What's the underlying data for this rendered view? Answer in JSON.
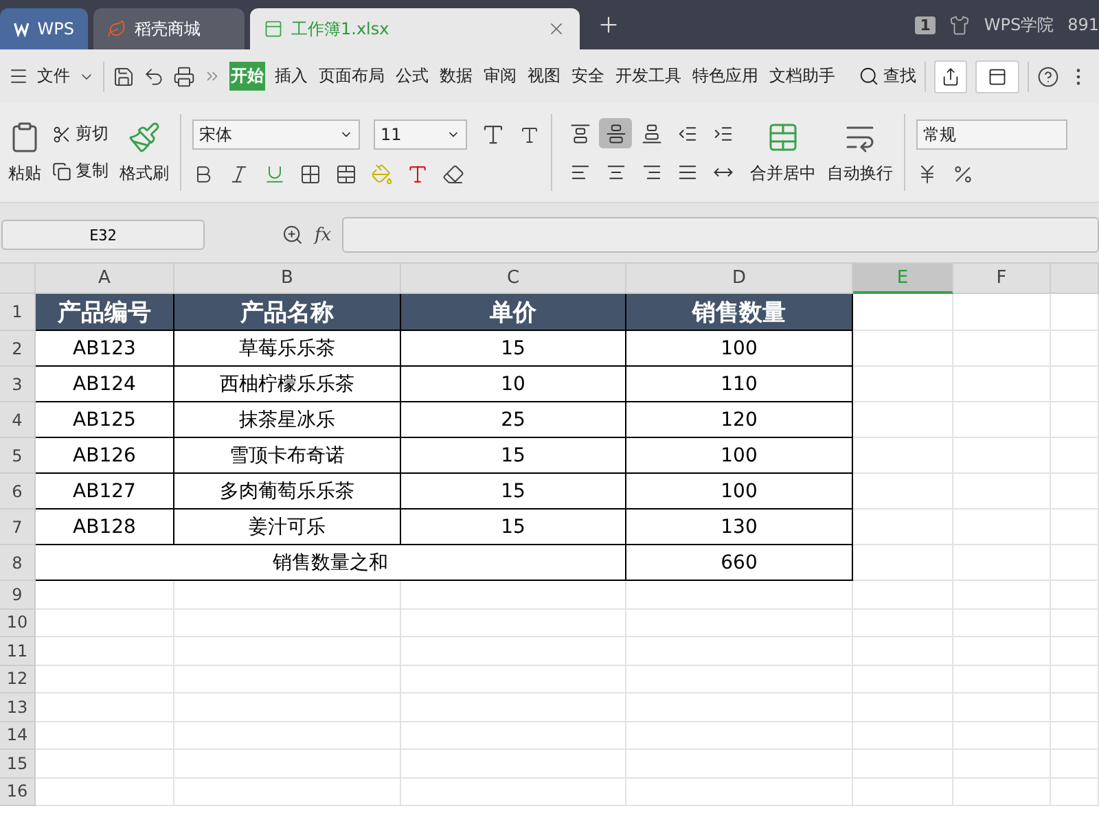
{
  "tabs": [
    {
      "kind": "home",
      "label": "WPS",
      "selected": false
    },
    {
      "kind": "store",
      "label": "稻壳商城",
      "selected": false
    },
    {
      "kind": "sheet",
      "label": "工作簿1.xlsx",
      "selected": true
    }
  ],
  "top_right": {
    "badge": "1",
    "account": "WPS学院",
    "count": "891"
  },
  "menu": {
    "file": "文件",
    "items": [
      {
        "label": "开始",
        "selected": true
      },
      {
        "label": "插入",
        "selected": false
      },
      {
        "label": "页面布局",
        "selected": false
      },
      {
        "label": "公式",
        "selected": false
      },
      {
        "label": "数据",
        "selected": false
      },
      {
        "label": "审阅",
        "selected": false
      },
      {
        "label": "视图",
        "selected": false
      },
      {
        "label": "安全",
        "selected": false
      },
      {
        "label": "开发工具",
        "selected": false
      },
      {
        "label": "特色应用",
        "selected": false
      },
      {
        "label": "文档助手",
        "selected": false
      }
    ],
    "search": "查找"
  },
  "ribbon": {
    "paste": "粘贴",
    "cut": "剪切",
    "copy": "复制",
    "format_painter": "格式刷",
    "font": "宋体",
    "font_size": "11",
    "align_buttons": [
      {
        "kind": "top",
        "selected": false
      },
      {
        "kind": "middle",
        "selected": true
      },
      {
        "kind": "bottom",
        "selected": false
      },
      {
        "kind": "outdent",
        "selected": false
      },
      {
        "kind": "indent",
        "selected": false
      },
      {
        "kind": "left",
        "selected": false
      },
      {
        "kind": "center",
        "selected": false
      },
      {
        "kind": "right",
        "selected": false
      },
      {
        "kind": "justify",
        "selected": false
      },
      {
        "kind": "distribute",
        "selected": false
      }
    ],
    "merge": "合并居中",
    "wrap": "自动换行",
    "number_format": "常规"
  },
  "formula_bar": {
    "name_box": "E32",
    "fx": "fx"
  },
  "sheet": {
    "columns": [
      {
        "label": "A",
        "selected": false
      },
      {
        "label": "B",
        "selected": false
      },
      {
        "label": "C",
        "selected": false
      },
      {
        "label": "D",
        "selected": false
      },
      {
        "label": "E",
        "selected": true
      },
      {
        "label": "F",
        "selected": false
      }
    ],
    "row_numbers": [
      "1",
      "2",
      "3",
      "4",
      "5",
      "6",
      "7",
      "8",
      "9",
      "10",
      "11",
      "12",
      "13",
      "14",
      "15",
      "16"
    ],
    "header": [
      "产品编号",
      "产品名称",
      "单价",
      "销售数量"
    ],
    "rows": [
      [
        "AB123",
        "草莓乐乐茶",
        "15",
        "100"
      ],
      [
        "AB124",
        "西柚柠檬乐乐茶",
        "10",
        "110"
      ],
      [
        "AB125",
        "抹茶星冰乐",
        "25",
        "120"
      ],
      [
        "AB126",
        "雪顶卡布奇诺",
        "15",
        "100"
      ],
      [
        "AB127",
        "多肉葡萄乐乐茶",
        "15",
        "100"
      ],
      [
        "AB128",
        "姜汁可乐",
        "15",
        "130"
      ]
    ],
    "total": {
      "label": "销售数量之和",
      "value": "660"
    }
  }
}
